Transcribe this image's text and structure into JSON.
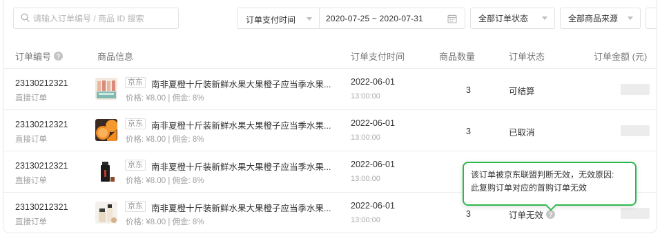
{
  "filters": {
    "search_placeholder": "请输入订单编号 / 商品 ID 搜索",
    "date_type_label": "订单支付时间",
    "date_range": "2020-07-25 ~ 2020-07-31",
    "status_select": "全部订单状态",
    "source_select": "全部商品来源"
  },
  "table": {
    "headers": {
      "order_no": "订单编号",
      "product_info": "商品信息",
      "pay_time": "订单支付时间",
      "quantity": "商品数量",
      "status": "订单状态",
      "amount": "订单金额 (元)"
    },
    "rows": [
      {
        "order_no": "23130212321",
        "order_type": "直接订单",
        "source_tag": "京东",
        "product_name": "南非夏橙十斤装新鲜水果大果橙子应当季水果...",
        "meta": "价格: ¥8.00 | 佣金: 8%",
        "date": "2022-06-01",
        "time": "13:00:00",
        "quantity": "3",
        "status": "可结算",
        "thumb": "bottles"
      },
      {
        "order_no": "23130212321",
        "order_type": "直接订单",
        "source_tag": "京东",
        "product_name": "南非夏橙十斤装新鲜水果大果橙子应当季水果...",
        "meta": "价格: ¥8.00 | 佣金: 8%",
        "date": "2022-06-01",
        "time": "13:00:00",
        "quantity": "3",
        "status": "已取消",
        "thumb": "oranges"
      },
      {
        "order_no": "23130212321",
        "order_type": "直接订单",
        "source_tag": "京东",
        "product_name": "南非夏橙十斤装新鲜水果大果橙子应当季水果...",
        "meta": "价格: ¥8.00 | 佣金: 8%",
        "date": "2022-06-01",
        "time": "13:00:00",
        "quantity": "",
        "status": "",
        "thumb": "dark-bottle"
      },
      {
        "order_no": "23130212321",
        "order_type": "直接订单",
        "source_tag": "京东",
        "product_name": "南非夏橙十斤装新鲜水果大果橙子应当季水果...",
        "meta": "价格: ¥8.00 | 佣金: 8%",
        "date": "2022-06-01",
        "time": "13:00:00",
        "quantity": "3",
        "status": "订单无效",
        "thumb": "cosmetics"
      }
    ]
  },
  "tooltip": {
    "line1": "该订单被京东联盟判断无效，无效原因:",
    "line2": "此复购订单对应的首购订单无效"
  },
  "colors": {
    "tooltip_border": "#2db84d"
  }
}
